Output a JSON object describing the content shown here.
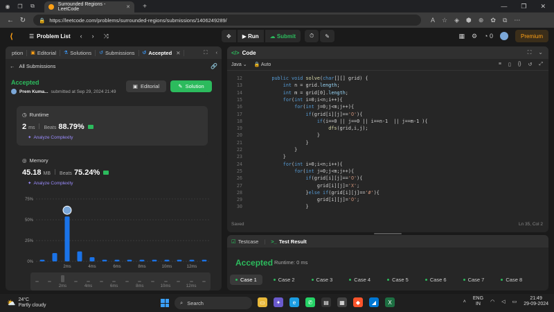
{
  "browser": {
    "tab_title": "Surrounded Regions - LeetCode",
    "url": "https://leetcode.com/problems/surrounded-regions/submissions/1406249289/"
  },
  "header": {
    "problem_list": "Problem List",
    "run": "Run",
    "submit": "Submit",
    "streak": "0",
    "premium": "Premium"
  },
  "left": {
    "tabs": [
      {
        "label": "ption"
      },
      {
        "label": "Editorial"
      },
      {
        "label": "Solutions"
      },
      {
        "label": "Submissions"
      },
      {
        "label": "Accepted"
      }
    ],
    "all_submissions": "All Submissions",
    "status": "Accepted",
    "author": "Prem Kuma...",
    "submitted_at": "submitted at Sep 29, 2024 21:49",
    "editorial_btn": "Editorial",
    "solution_btn": "Solution",
    "runtime": {
      "title": "Runtime",
      "value": "2",
      "unit": "ms",
      "beats_label": "Beats",
      "beats": "88.79%",
      "analyze": "Analyze Complexity"
    },
    "memory": {
      "title": "Memory",
      "value": "45.18",
      "unit": "MB",
      "beats_label": "Beats",
      "beats": "75.24%",
      "analyze": "Analyze Complexity"
    }
  },
  "chart_data": {
    "type": "bar",
    "categories": [
      "0ms",
      "1ms",
      "2ms",
      "3ms",
      "4ms",
      "5ms",
      "6ms",
      "7ms",
      "8ms",
      "9ms",
      "10ms",
      "11ms",
      "12ms",
      "13ms"
    ],
    "values": [
      2,
      10,
      54,
      12,
      5,
      2,
      2,
      2,
      2,
      2,
      2,
      2,
      2,
      2
    ],
    "highlight_index": 2,
    "yticks": [
      "0%",
      "25%",
      "50%",
      "75%"
    ],
    "ylim": [
      0,
      75
    ],
    "xticks": [
      "2ms",
      "4ms",
      "6ms",
      "8ms",
      "10ms",
      "12ms"
    ],
    "bar_color": "#1a73e8",
    "mini_xticks": [
      "2ms",
      "4ms",
      "6ms",
      "8ms",
      "10ms",
      "12ms"
    ]
  },
  "code": {
    "title": "Code",
    "language": "Java",
    "mode": "Auto",
    "status": "Saved",
    "position": "Ln 35, Col 2",
    "lines": [
      {
        "n": "12",
        "t": "    public void solve(char[][] grid) {"
      },
      {
        "n": "13",
        "t": "        int n = grid.length;"
      },
      {
        "n": "14",
        "t": "        int m = grid[0].length;"
      },
      {
        "n": "15",
        "t": "        for(int i=0;i<n;i++){"
      },
      {
        "n": "16",
        "t": "            for(int j=0;j<m;j++){"
      },
      {
        "n": "17",
        "t": "                if(grid[i][j]=='O'){"
      },
      {
        "n": "18",
        "t": "                    if(i==0 || j==0 || i==n-1  || j==m-1 ){"
      },
      {
        "n": "19",
        "t": "                        dfs(grid,i,j);"
      },
      {
        "n": "20",
        "t": "                    }"
      },
      {
        "n": "21",
        "t": "                }"
      },
      {
        "n": "22",
        "t": "            }"
      },
      {
        "n": "23",
        "t": "        }"
      },
      {
        "n": "24",
        "t": "        for(int i=0;i<n;i++){"
      },
      {
        "n": "25",
        "t": "            for(int j=0;j<m;j++){"
      },
      {
        "n": "26",
        "t": "                if(grid[i][j]=='O'){"
      },
      {
        "n": "27",
        "t": "                    grid[i][j]='X';"
      },
      {
        "n": "28",
        "t": "                }else if(grid[i][j]=='#'){"
      },
      {
        "n": "29",
        "t": "                    grid[i][j]='O';"
      },
      {
        "n": "30",
        "t": "                }"
      }
    ]
  },
  "test": {
    "tab_testcase": "Testcase",
    "tab_result": "Test Result",
    "result": "Accepted",
    "runtime": "Runtime: 0 ms",
    "cases": [
      "Case 1",
      "Case 2",
      "Case 3",
      "Case 4",
      "Case 5",
      "Case 6",
      "Case 7",
      "Case 8"
    ]
  },
  "taskbar": {
    "temp": "24°C",
    "weather": "Partly cloudy",
    "search": "Search",
    "lang1": "ENG",
    "lang2": "IN",
    "time": "21:49",
    "date": "29-09-2024"
  }
}
